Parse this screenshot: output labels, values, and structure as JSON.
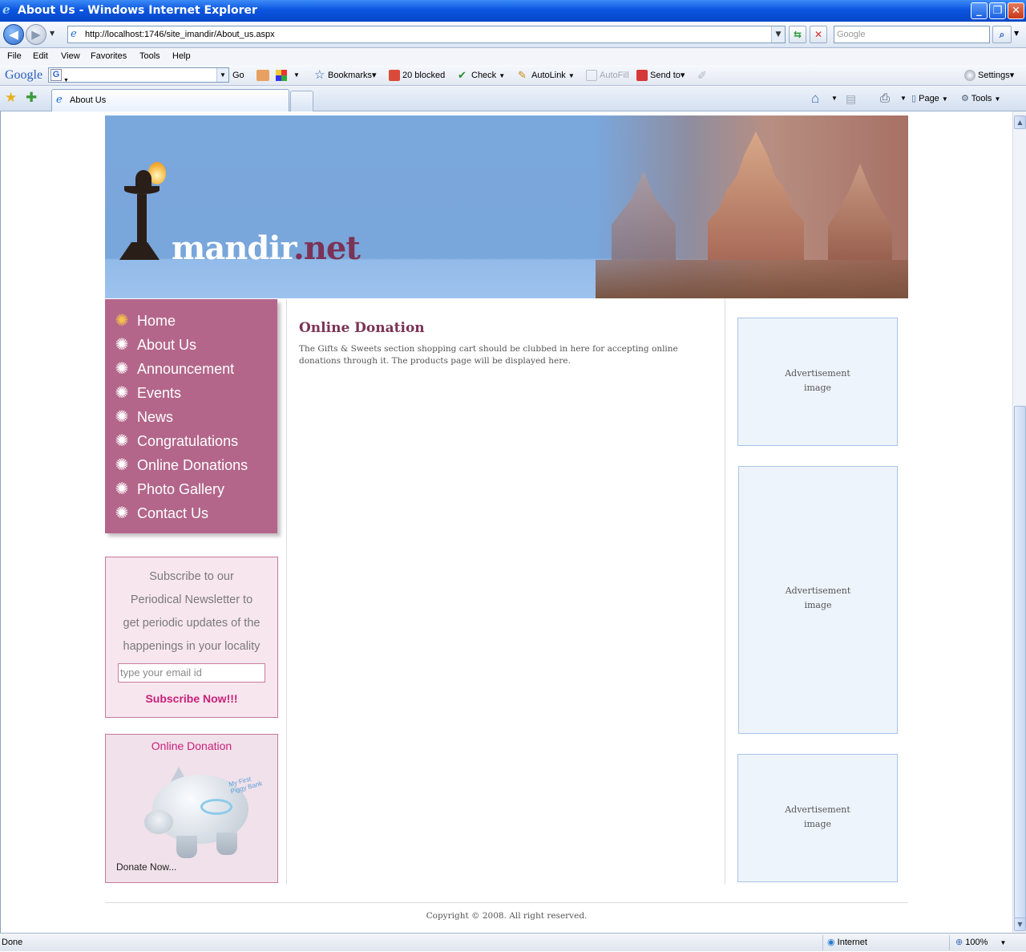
{
  "window": {
    "title": "About Us - Windows Internet Explorer",
    "minimize_glyph": "_",
    "restore_glyph": "❐",
    "close_glyph": "✕"
  },
  "address_bar": {
    "url": "http://localhost:1746/site_imandir/About_us.aspx",
    "search_placeholder": "Google"
  },
  "menu": [
    "File",
    "Edit",
    "View",
    "Favorites",
    "Tools",
    "Help"
  ],
  "google_toolbar": {
    "logo": "Google",
    "go_label": "Go",
    "bookmarks_label": "Bookmarks▾",
    "blocked_label": "20 blocked",
    "check_label": "Check",
    "autolink_label": "AutoLink",
    "autofill_label": "AutoFill",
    "sendto_label": "Send to▾",
    "settings_label": "Settings▾"
  },
  "tabs": {
    "active_tab_label": "About Us",
    "page_label": "Page",
    "tools_label": "Tools"
  },
  "site": {
    "logo_main": "mandir",
    "logo_suffix": ".net",
    "nav": [
      "Home",
      "About Us",
      "Announcement",
      "Events",
      "News",
      "Congratulations",
      "Online Donations",
      "Photo Gallery",
      "Contact Us"
    ],
    "newsletter": {
      "text_lines": [
        "Subscribe to our",
        "Periodical Newsletter to",
        "get periodic updates of the",
        "happenings in your locality"
      ],
      "email_placeholder": "type your email id",
      "subscribe_label": "Subscribe Now!!!"
    },
    "donation_box": {
      "title": "Online Donation",
      "piggy_text": "My First Piggy Bank",
      "donate_label": "Donate Now..."
    },
    "main": {
      "title": "Online Donation",
      "body": "The Gifts & Sweets section shopping cart should be clubbed in here for accepting online donations through it. The products page will be displayed here."
    },
    "ads": [
      {
        "line1": "Advertisement",
        "line2": "image"
      },
      {
        "line1": "Advertisement",
        "line2": "image"
      },
      {
        "line1": "Advertisement",
        "line2": "image"
      }
    ],
    "copyright": "Copyright © 2008. All right reserved."
  },
  "status_bar": {
    "status": "Done",
    "zone": "Internet",
    "zoom": "100%"
  },
  "colors": {
    "nav_bg": "#b3668a",
    "accent": "#7b3355",
    "subscribe": "#c8207a",
    "ad_bg": "#eef4fc"
  }
}
